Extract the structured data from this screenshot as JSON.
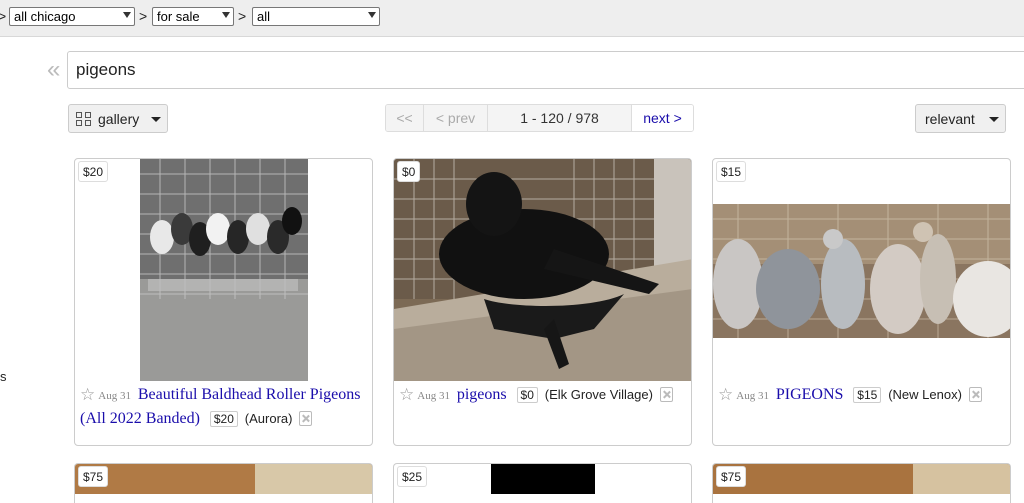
{
  "breadcrumb": {
    "separator_start": ">",
    "separator": ">",
    "area": "all chicago",
    "section": "for sale",
    "category": "all"
  },
  "sidebar_fragment": "s",
  "search": {
    "collapse_glyph": "«",
    "query": "pigeons"
  },
  "toolbar": {
    "view_label": "gallery",
    "first_label": "<<",
    "prev_label": "< prev",
    "range_label": "1 - 120 / 978",
    "next_label": "next >",
    "sort_label": "relevant"
  },
  "listings": [
    {
      "price_tag": "$20",
      "date": "Aug 31",
      "title": "Beautiful Baldhead Roller Pigeons (All 2022 Banded)",
      "price": "$20",
      "location": "(Aurora)"
    },
    {
      "price_tag": "$0",
      "date": "Aug 31",
      "title": "pigeons",
      "price": "$0",
      "location": "(Elk Grove Village)"
    },
    {
      "price_tag": "$15",
      "date": "Aug 31",
      "title": "PIGEONS",
      "price": "$15",
      "location": "(New Lenox)"
    },
    {
      "price_tag": "$75"
    },
    {
      "price_tag": "$25"
    },
    {
      "price_tag": "$75"
    }
  ],
  "icons": {
    "star": "star-icon",
    "hide": "hide-listing-icon",
    "grid": "grid-view-icon"
  }
}
